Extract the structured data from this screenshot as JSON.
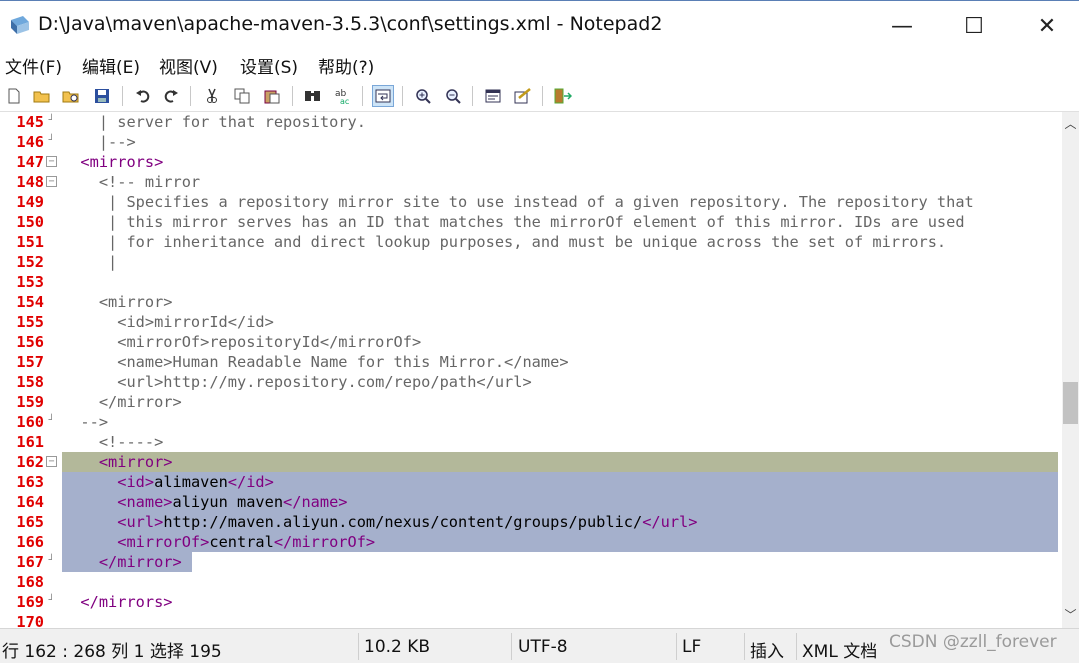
{
  "window": {
    "title": "D:\\Java\\maven\\apache-maven-3.5.3\\conf\\settings.xml - Notepad2",
    "minimize_glyph": "—",
    "maximize_glyph": "☐",
    "close_glyph": "✕"
  },
  "menu": [
    "文件(F)",
    "编辑(E)",
    "视图(V)",
    "设置(S)",
    "帮助(?)"
  ],
  "toolbar": {
    "buttons": [
      "new-file-icon",
      "open-folder-icon",
      "browse-icon",
      "save-icon",
      "undo-icon",
      "redo-icon",
      "cut-icon",
      "copy-icon",
      "paste-icon",
      "find-icon",
      "replace-icon",
      "word-wrap-icon",
      "zoom-in-icon",
      "zoom-out-icon",
      "settings-icon",
      "scheme-icon",
      "exit-icon"
    ],
    "active_button": "word-wrap-icon"
  },
  "editor": {
    "current_line": 162,
    "lines": [
      {
        "n": "145",
        "fold": "tick",
        "hl": "",
        "parts": [
          [
            "comment",
            "    | server for that repository."
          ]
        ]
      },
      {
        "n": "146",
        "fold": "tick",
        "hl": "",
        "parts": [
          [
            "comment",
            "    |-->"
          ]
        ]
      },
      {
        "n": "147",
        "fold": "minus",
        "hl": "",
        "parts": [
          [
            "tag",
            "  <mirrors>"
          ]
        ]
      },
      {
        "n": "148",
        "fold": "minus",
        "hl": "",
        "parts": [
          [
            "comment",
            "    <!-- mirror"
          ]
        ]
      },
      {
        "n": "149",
        "fold": "",
        "hl": "",
        "parts": [
          [
            "comment",
            "     | Specifies a repository mirror site to use instead of a given repository. The repository that"
          ]
        ]
      },
      {
        "n": "150",
        "fold": "",
        "hl": "",
        "parts": [
          [
            "comment",
            "     | this mirror serves has an ID that matches the mirrorOf element of this mirror. IDs are used"
          ]
        ]
      },
      {
        "n": "151",
        "fold": "",
        "hl": "",
        "parts": [
          [
            "comment",
            "     | for inheritance and direct lookup purposes, and must be unique across the set of mirrors."
          ]
        ]
      },
      {
        "n": "152",
        "fold": "",
        "hl": "",
        "parts": [
          [
            "comment",
            "     |"
          ]
        ]
      },
      {
        "n": "153",
        "fold": "",
        "hl": "",
        "parts": [
          [
            "comment",
            ""
          ]
        ]
      },
      {
        "n": "154",
        "fold": "",
        "hl": "",
        "parts": [
          [
            "comment",
            "    <mirror>"
          ]
        ]
      },
      {
        "n": "155",
        "fold": "",
        "hl": "",
        "parts": [
          [
            "comment",
            "      <id>mirrorId</id>"
          ]
        ]
      },
      {
        "n": "156",
        "fold": "",
        "hl": "",
        "parts": [
          [
            "comment",
            "      <mirrorOf>repositoryId</mirrorOf>"
          ]
        ]
      },
      {
        "n": "157",
        "fold": "",
        "hl": "",
        "parts": [
          [
            "comment",
            "      <name>Human Readable Name for this Mirror.</name>"
          ]
        ]
      },
      {
        "n": "158",
        "fold": "",
        "hl": "",
        "parts": [
          [
            "comment",
            "      <url>http://my.repository.com/repo/path</url>"
          ]
        ]
      },
      {
        "n": "159",
        "fold": "",
        "hl": "",
        "parts": [
          [
            "comment",
            "    </mirror>"
          ]
        ]
      },
      {
        "n": "160",
        "fold": "tick",
        "hl": "",
        "parts": [
          [
            "comment",
            "  -->"
          ]
        ]
      },
      {
        "n": "161",
        "fold": "",
        "hl": "",
        "parts": [
          [
            "comment",
            "    <!---->"
          ]
        ]
      },
      {
        "n": "162",
        "fold": "minus",
        "hl": "cur",
        "parts": [
          [
            "tag",
            "    <mirror>"
          ]
        ]
      },
      {
        "n": "163",
        "fold": "",
        "hl": "full",
        "parts": [
          [
            "tag",
            "      <id>"
          ],
          [
            "txt",
            "alimaven"
          ],
          [
            "tag",
            "</id>"
          ]
        ]
      },
      {
        "n": "164",
        "fold": "",
        "hl": "full",
        "parts": [
          [
            "tag",
            "      <name>"
          ],
          [
            "txt",
            "aliyun maven"
          ],
          [
            "tag",
            "</name>"
          ]
        ]
      },
      {
        "n": "165",
        "fold": "",
        "hl": "full",
        "parts": [
          [
            "tag",
            "      <url>"
          ],
          [
            "txt",
            "http://maven.aliyun.com/nexus/content/groups/public/"
          ],
          [
            "tag",
            "</url>"
          ]
        ]
      },
      {
        "n": "166",
        "fold": "",
        "hl": "full",
        "parts": [
          [
            "tag",
            "      <mirrorOf>"
          ],
          [
            "txt",
            "central"
          ],
          [
            "tag",
            "</mirrorOf>"
          ]
        ]
      },
      {
        "n": "167",
        "fold": "tick",
        "hl": "part",
        "parts": [
          [
            "tag",
            "    </mirror>"
          ]
        ]
      },
      {
        "n": "168",
        "fold": "",
        "hl": "",
        "parts": [
          [
            "comment",
            ""
          ]
        ]
      },
      {
        "n": "169",
        "fold": "tick",
        "hl": "",
        "parts": [
          [
            "tag",
            "  </mirrors>"
          ]
        ]
      },
      {
        "n": "170",
        "fold": "",
        "hl": "",
        "parts": [
          [
            "comment",
            ""
          ]
        ]
      }
    ]
  },
  "status": {
    "position": "行 162 : 268  列 1  选择 195",
    "size": "10.2 KB",
    "encoding": "UTF-8",
    "eol": "LF",
    "mode": "插入",
    "lexer": "XML 文档"
  },
  "watermark": "CSDN @zzll_forever",
  "colors": {
    "line_number": "#e00000",
    "tag": "#800080",
    "selection": "#a5b0cc",
    "current_line": "#b3b89a"
  }
}
